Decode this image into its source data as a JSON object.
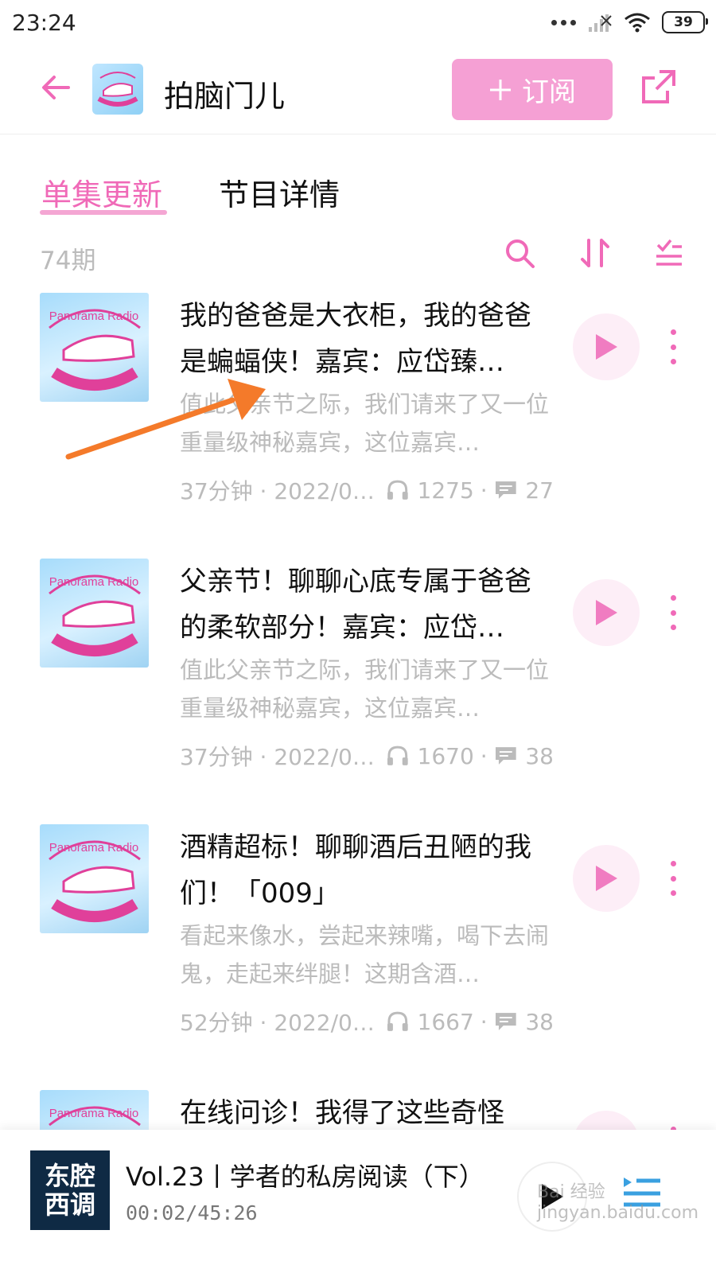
{
  "status_bar": {
    "time": "23:24",
    "battery": "39"
  },
  "header": {
    "title": "拍脑门儿",
    "subscribe_label": "订阅"
  },
  "tabs": [
    {
      "label": "单集更新",
      "active": true
    },
    {
      "label": "节目详情",
      "active": false
    }
  ],
  "list_header": {
    "count": "74期"
  },
  "episodes": [
    {
      "title": "我的爸爸是大衣柜，我的爸爸是蝙蝠侠！嘉宾：应岱臻…",
      "description": "值此父亲节之际，我们请来了又一位重量级神秘嘉宾，这位嘉宾…",
      "duration_date": "37分钟 · 2022/0…",
      "plays": "1275",
      "comments": "27"
    },
    {
      "title": "父亲节！聊聊心底专属于爸爸的柔软部分！嘉宾：应岱…",
      "description": "值此父亲节之际，我们请来了又一位重量级神秘嘉宾，这位嘉宾…",
      "duration_date": "37分钟 · 2022/0…",
      "plays": "1670",
      "comments": "38"
    },
    {
      "title": "酒精超标！聊聊酒后丑陋的我们！「009」",
      "description": "看起来像水，尝起来辣嘴，喝下去闹鬼，走起来绊腿！这期含酒…",
      "duration_date": "52分钟 · 2022/0…",
      "plays": "1667",
      "comments": "38"
    },
    {
      "title": "在线问诊！我得了这些奇怪",
      "description": "",
      "duration_date": "",
      "plays": "",
      "comments": ""
    }
  ],
  "player": {
    "cover_text_1": "东腔",
    "cover_text_2": "西调",
    "title": "Vol.23丨学者的私房阅读（下）",
    "time": "00:02/45:26"
  },
  "colors": {
    "accent": "#f06ab8",
    "accent_light": "#f5a0d4",
    "muted": "#bbbbbb",
    "arrow": "#f47a2a"
  },
  "cover_art_text": "Panorama Radio",
  "watermark": "Bai 经验 jingyan.baidu.com"
}
